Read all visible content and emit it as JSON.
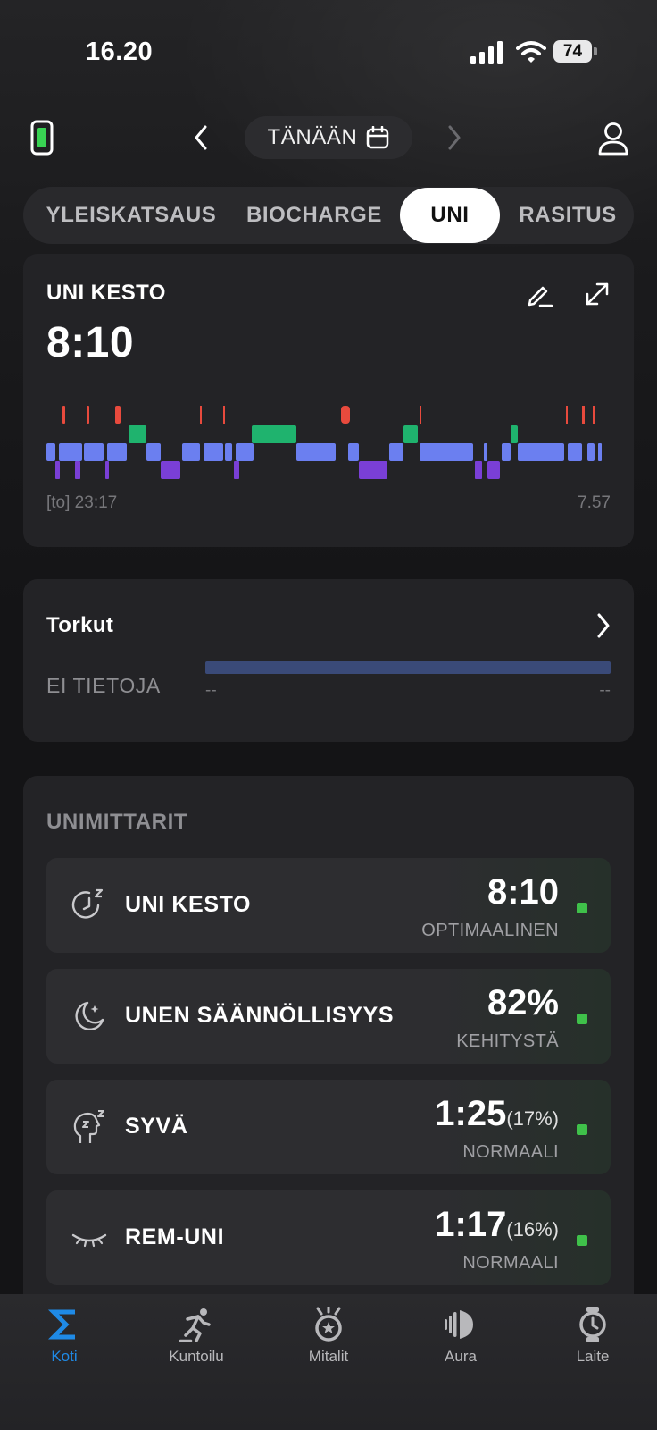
{
  "status_bar": {
    "time": "16.20",
    "battery": "74"
  },
  "date_nav": {
    "label": "TÄNÄÄN"
  },
  "tabs": [
    {
      "label": "YLEISKATSAUS"
    },
    {
      "label": "BIOCHARGE"
    },
    {
      "label": "UNI",
      "active": true
    },
    {
      "label": "RASITUS"
    }
  ],
  "sleep_card": {
    "title": "UNI KESTO",
    "value": "8:10",
    "start_label": "[to] 23:17",
    "end_label": "7.57",
    "stage_colors": {
      "awake": "#e84a3d",
      "rem": "#1fb36e",
      "light": "#6b7ff0",
      "deep": "#7a3fd6"
    }
  },
  "naps": {
    "title": "Torkut",
    "status": "EI TIETOJA",
    "start": "--",
    "end": "--"
  },
  "metrics": {
    "title": "UNIMITTARIT",
    "items": [
      {
        "label": "UNI KESTO",
        "value": "8:10",
        "pct": "",
        "status": "OPTIMAALINEN",
        "icon": "sleep-timer-icon"
      },
      {
        "label": "UNEN SÄÄNNÖLLISYYS",
        "value": "82%",
        "pct": "",
        "status": "KEHITYSTÄ",
        "icon": "moon-icon"
      },
      {
        "label": "SYVÄ",
        "value": "1:25",
        "pct": "(17%)",
        "status": "NORMAALI",
        "icon": "head-sleep-icon"
      },
      {
        "label": "REM-UNI",
        "value": "1:17",
        "pct": "(16%)",
        "status": "NORMAALI",
        "icon": "closed-eye-icon"
      }
    ]
  },
  "bottom_nav": [
    {
      "label": "Koti",
      "icon": "sigma-icon",
      "active": true
    },
    {
      "label": "Kuntoilu",
      "icon": "running-icon"
    },
    {
      "label": "Mitalit",
      "icon": "medal-icon"
    },
    {
      "label": "Aura",
      "icon": "aura-icon"
    },
    {
      "label": "Laite",
      "icon": "watch-icon"
    }
  ]
}
